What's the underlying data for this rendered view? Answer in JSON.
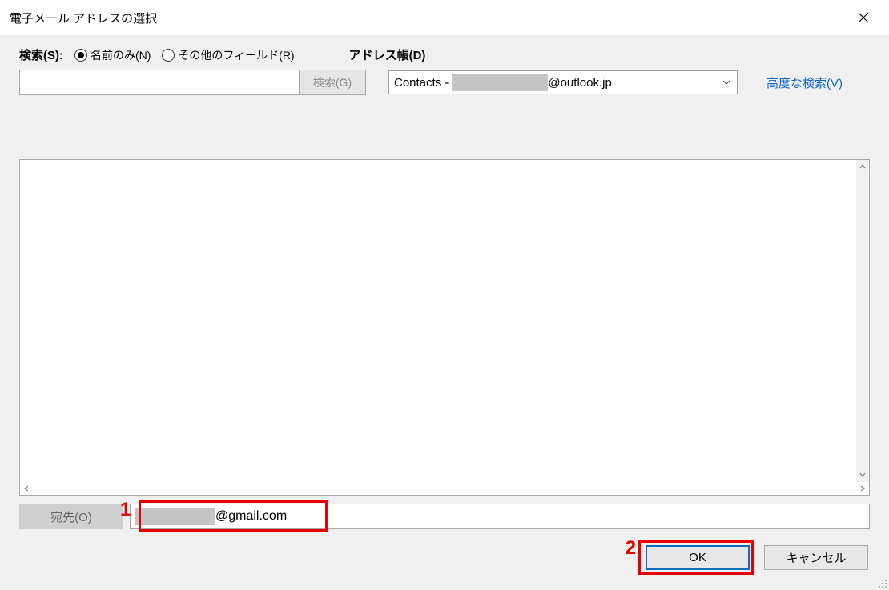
{
  "title": "電子メール アドレスの選択",
  "search": {
    "label": "検索(S):",
    "radio_name_only": "名前のみ(N)",
    "radio_other_fields": "その他のフィールド(R)",
    "go_button": "検索(G)",
    "input_value": ""
  },
  "addressbook": {
    "label": "アドレス帳(D)",
    "value_prefix": "Contacts -",
    "value_suffix": "@outlook.jp"
  },
  "advanced_search": "高度な検索(V)",
  "recipient": {
    "to_button": "宛先(O)",
    "value_suffix": "@gmail.com"
  },
  "buttons": {
    "ok": "OK",
    "cancel": "キャンセル"
  },
  "annotations": {
    "one": "1",
    "two": "2"
  }
}
